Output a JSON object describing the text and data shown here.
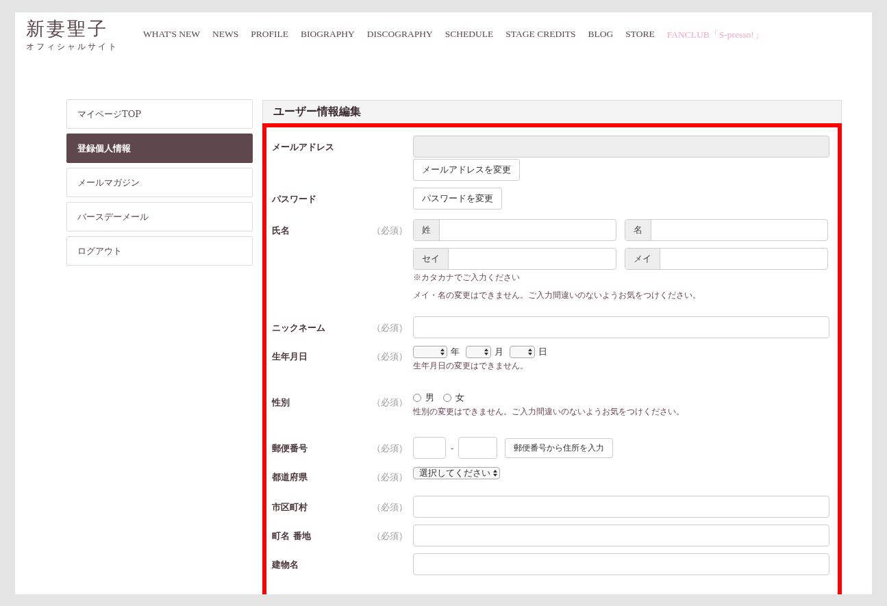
{
  "logo": {
    "title": "新妻聖子",
    "subtitle": "オフィシャルサイト"
  },
  "nav": [
    {
      "label": "WHAT'S NEW",
      "kind": "normal"
    },
    {
      "label": "NEWS",
      "kind": "normal"
    },
    {
      "label": "PROFILE",
      "kind": "normal"
    },
    {
      "label": "BIOGRAPHY",
      "kind": "normal"
    },
    {
      "label": "DISCOGRAPHY",
      "kind": "normal"
    },
    {
      "label": "SCHEDULE",
      "kind": "normal"
    },
    {
      "label": "STAGE CREDITS",
      "kind": "normal"
    },
    {
      "label": "BLOG",
      "kind": "normal"
    },
    {
      "label": "STORE",
      "kind": "normal"
    },
    {
      "label": "FANCLUB「S-presso!」",
      "kind": "fanclub"
    }
  ],
  "sidebar": {
    "items": [
      {
        "label": "マイページTOP",
        "selected": false
      },
      {
        "label": "登録個人情報",
        "selected": true
      },
      {
        "label": "メールマガジン",
        "selected": false
      },
      {
        "label": "バースデーメール",
        "selected": false
      },
      {
        "label": "ログアウト",
        "selected": false
      }
    ]
  },
  "form": {
    "title": "ユーザー情報編集",
    "fields": [
      {
        "kind": "email",
        "label": "メールアドレス",
        "button": "メールアドレスを変更"
      },
      {
        "kind": "password",
        "label": "パスワード",
        "button": "パスワードを変更"
      },
      {
        "kind": "name",
        "label": "氏名",
        "required": "（必須）",
        "inputs": [
          {
            "prefix": "姓"
          },
          {
            "prefix": "名"
          },
          {
            "prefix": "セイ"
          },
          {
            "prefix": "メイ"
          }
        ],
        "notes": [
          "※カタカナでご入力ください",
          "メイ・名の変更はできません。ご入力間違いのないようお気をつけください。"
        ]
      },
      {
        "kind": "text",
        "label": "ニックネーム",
        "required": "（必須）"
      },
      {
        "kind": "date",
        "label": "生年月日",
        "required": "（必須）",
        "units": [
          "年",
          "月",
          "日"
        ],
        "notes": [
          "生年月日の変更はできません。"
        ]
      },
      {
        "kind": "radio",
        "label": "性別",
        "required": "（必須）",
        "options": [
          {
            "label": "男",
            "selected": false
          },
          {
            "label": "女",
            "selected": false
          }
        ],
        "notes": [
          "性別の変更はできません。ご入力間違いのないようお気をつけください。"
        ]
      },
      {
        "kind": "postal",
        "label": "郵便番号",
        "required": "（必須）",
        "separator": "-",
        "button": "郵便番号から住所を入力"
      },
      {
        "kind": "select",
        "label": "都道府県",
        "required": "（必須）",
        "value": "選択してください"
      },
      {
        "kind": "text",
        "label": "市区町村",
        "required": "（必須）"
      },
      {
        "kind": "text",
        "label": "町名 番地",
        "required": "（必須）"
      },
      {
        "kind": "text",
        "label": "建物名"
      }
    ]
  }
}
